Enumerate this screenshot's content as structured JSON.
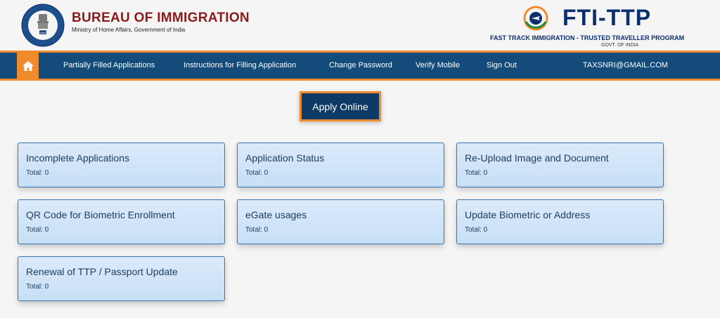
{
  "header": {
    "bureau_title": "BUREAU OF IMMIGRATION",
    "bureau_subtitle": "Ministry of Home Affairs, Government of India",
    "emblem_text_top": "BUREAU OF IMMIGRATION",
    "emblem_text_bottom": "MINISTRY OF HOME AFFAIRS",
    "emblem_india": "INDIA",
    "fti_title": "FTI-TTP",
    "fti_subtitle": "FAST TRACK IMMIGRATION - TRUSTED TRAVELLER PROGRAM",
    "fti_govt": "GOVT. OF INDIA"
  },
  "nav": {
    "home_icon": "home-icon",
    "items": [
      {
        "label": "Partially Filled Applications"
      },
      {
        "label": "Instructions for Filling Application"
      },
      {
        "label": "Change Password"
      },
      {
        "label": "Verify Mobile"
      },
      {
        "label": "Sign Out"
      }
    ],
    "user_email": "TAXSNRI@GMAIL.COM"
  },
  "apply_button": "Apply Online",
  "cards": [
    {
      "title": "Incomplete Applications",
      "total": "Total: 0"
    },
    {
      "title": "Application Status",
      "total": "Total: 0"
    },
    {
      "title": "Re-Upload Image and Document",
      "total": "Total: 0"
    },
    {
      "title": "QR Code for Biometric Enrollment",
      "total": "Total: 0"
    },
    {
      "title": "eGate usages",
      "total": "Total: 0"
    },
    {
      "title": "Update Biometric or Address",
      "total": "Total: 0"
    },
    {
      "title": "Renewal of TTP / Passport Update",
      "total": "Total: 0"
    }
  ],
  "colors": {
    "nav_bg": "#134b7a",
    "accent_orange": "#f08b2c",
    "bureau_red": "#8b1a1a",
    "fti_blue": "#0d2e6e",
    "card_border": "#3a74b0"
  }
}
